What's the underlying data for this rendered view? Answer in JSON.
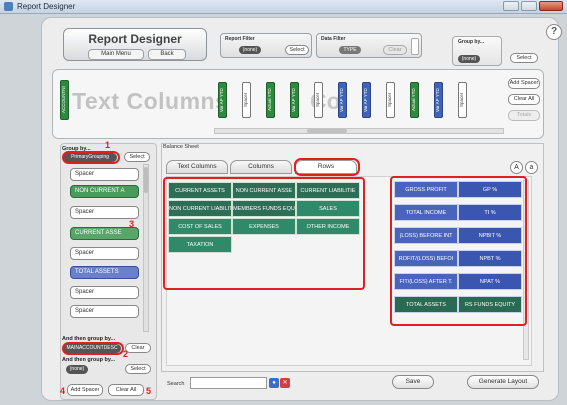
{
  "window": {
    "title": "Report Designer"
  },
  "header": {
    "title": "Report Designer",
    "main_menu": "Main Menu",
    "back": "Back",
    "help": "?"
  },
  "report_filter": {
    "label": "Report Filter",
    "value": "(none)",
    "select": "Select"
  },
  "data_filter": {
    "label": "Data Filter",
    "value": "TYPE",
    "clear": "Clear"
  },
  "group_by_top": {
    "label": "Group by...",
    "value": "(none)",
    "select": "Select"
  },
  "text_columns": {
    "heading": "Text Columns",
    "watermark": "Col",
    "cards": [
      {
        "label": "ACCOUNTNI",
        "style": "green"
      },
      {
        "label": "Var AP YTD",
        "style": "green"
      },
      {
        "label": "Spacer",
        "style": "white"
      },
      {
        "label": "Actual YTD",
        "style": "green"
      },
      {
        "label": "Var AP YTD",
        "style": "green"
      },
      {
        "label": "Spacer",
        "style": "white"
      },
      {
        "label": "Var AP YTD",
        "style": "blue"
      },
      {
        "label": "Var AP YTD",
        "style": "blue"
      },
      {
        "label": "Spacer",
        "style": "white"
      },
      {
        "label": "Actual YTD",
        "style": "green"
      },
      {
        "label": "Var AP YTD",
        "style": "blue"
      },
      {
        "label": "Spacer",
        "style": "white"
      }
    ],
    "add_spacer": "Add Spacer",
    "clear_all": "Clear All",
    "totals": "Totals"
  },
  "left_panel": {
    "group_by_label": "Group by...",
    "group_by_value": "PrimaryGrouping",
    "select": "Select",
    "items": [
      {
        "label": "Spacer",
        "style": "spacer"
      },
      {
        "label": "NON CURRENT A",
        "style": "green"
      },
      {
        "label": "Spacer",
        "style": "spacer"
      },
      {
        "label": "CURRENT ASSE",
        "style": "green2"
      },
      {
        "label": "Spacer",
        "style": "spacer"
      },
      {
        "label": "TOTAL ASSETS",
        "style": "blue"
      },
      {
        "label": "Spacer",
        "style": "spacer"
      },
      {
        "label": "Spacer",
        "style": "spacer"
      }
    ],
    "then_group_1_label": "And then group by...",
    "then_group_1_value": "MAINACCOUNTDESC",
    "clear": "Clear",
    "then_group_2_label": "And then group by...",
    "then_group_2_value": "(none)",
    "add_spacer": "Add Spacer",
    "clear_all": "Clear All"
  },
  "balance_sheet": {
    "label": "Balance Sheet",
    "tabs": [
      "Text Columns",
      "Columns",
      "Rows"
    ],
    "font_up": "A",
    "font_down": "a"
  },
  "left_grid": [
    {
      "label": "CURRENT ASSETS",
      "style": "dg"
    },
    {
      "label": "NON CURRENT ASSE",
      "style": "dg"
    },
    {
      "label": "CURRENT LIABILITIE",
      "style": "dg"
    },
    {
      "label": "NON CURRENT LIABILIT",
      "style": "dg"
    },
    {
      "label": "MEMBERS FUNDS EQU",
      "style": "dg"
    },
    {
      "label": "SALES",
      "style": "mg"
    },
    {
      "label": "COST OF SALES",
      "style": "mg"
    },
    {
      "label": "EXPENSES",
      "style": "mg"
    },
    {
      "label": "OTHER INCOME",
      "style": "mg"
    },
    {
      "label": "TAXATION",
      "style": "mg"
    }
  ],
  "right_grid": [
    {
      "label": "GROSS PROFIT",
      "style": "bl"
    },
    {
      "label": "GP %",
      "style": "bl2"
    },
    {
      "label": "TOTAL INCOME",
      "style": "bl"
    },
    {
      "label": "TI %",
      "style": "bl2"
    },
    {
      "label": "(LOSS) BEFORE INT",
      "style": "bl"
    },
    {
      "label": "NPBIT %",
      "style": "bl2"
    },
    {
      "label": "ROFIT/(LOSS) BEFOI",
      "style": "bl"
    },
    {
      "label": "NPBT %",
      "style": "bl2"
    },
    {
      "label": "FIT/(LOSS) AFTER T.",
      "style": "bl"
    },
    {
      "label": "NPAT %",
      "style": "bl2"
    },
    {
      "label": "TOTAL ASSETS",
      "style": "dgr"
    },
    {
      "label": "RS FUNDS EQUITY",
      "style": "dgr"
    }
  ],
  "annotations": [
    "1",
    "2",
    "3",
    "4",
    "5"
  ],
  "bottom": {
    "search_label": "Search",
    "search_value": "",
    "save": "Save",
    "generate_layout": "Generate Layout"
  }
}
